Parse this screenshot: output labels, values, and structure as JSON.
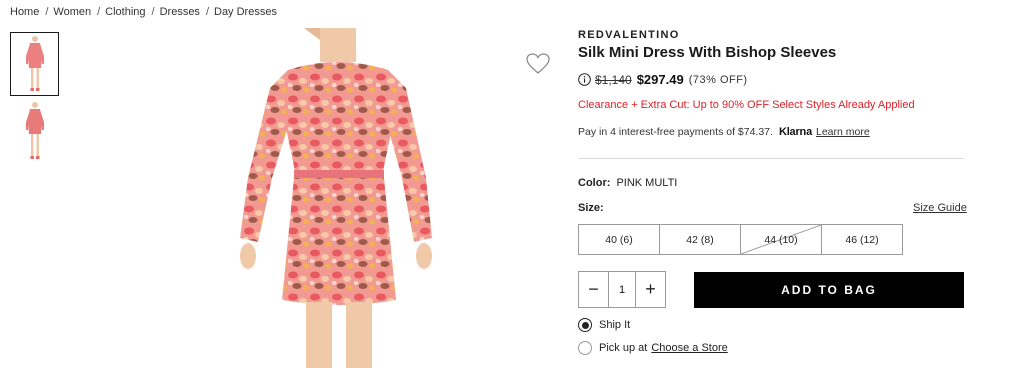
{
  "breadcrumb": [
    "Home",
    "Women",
    "Clothing",
    "Dresses",
    "Day Dresses"
  ],
  "product": {
    "brand": "REDVALENTINO",
    "title": "Silk Mini Dress With Bishop Sleeves",
    "price_was": "$1,140",
    "price_now": "$297.49",
    "price_off": "(73% OFF)",
    "clearance": "Clearance + Extra Cut: Up to 90% OFF Select Styles Already Applied",
    "klarna_text": "Pay in 4 interest-free payments of $74.37.",
    "klarna_brand": "Klarna",
    "klarna_link": "Learn more",
    "color_label": "Color:",
    "color_value": "PINK MULTI",
    "size_label": "Size:",
    "size_guide": "Size Guide",
    "sizes": [
      {
        "label": "40 (6)",
        "available": true
      },
      {
        "label": "42 (8)",
        "available": true
      },
      {
        "label": "44 (10)",
        "available": false
      },
      {
        "label": "46 (12)",
        "available": true
      }
    ],
    "quantity": "1",
    "qty_minus": "−",
    "qty_plus": "+",
    "add_to_bag": "ADD TO BAG",
    "ship_label": "Ship It",
    "pickup_label": "Pick up at",
    "pickup_link": "Choose a Store"
  },
  "icons": {
    "wishlist": "heart-outline-icon",
    "price_info": "info-circle-icon"
  },
  "colors": {
    "accent": "#000000",
    "sale_red": "#d8232a",
    "dress_pink": "#f08a8a"
  }
}
